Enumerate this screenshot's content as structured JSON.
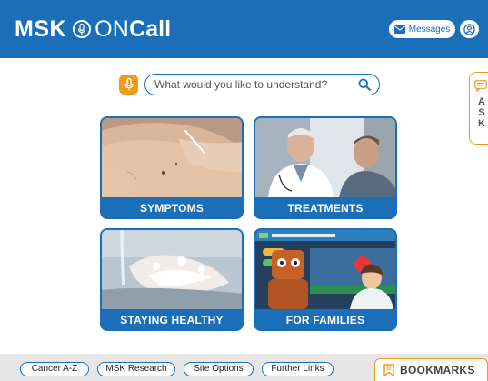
{
  "header": {
    "brand_msk": "MSK",
    "brand_on": "ON",
    "brand_call": "Call",
    "messages_label": "Messages"
  },
  "search": {
    "placeholder": "What would you like to understand?"
  },
  "ask_tab": {
    "letters": "A S K"
  },
  "tiles": [
    {
      "caption": "SYMPTOMS"
    },
    {
      "caption": "TREATMENTS"
    },
    {
      "caption": "STAYING HEALTHY"
    },
    {
      "caption": "FOR FAMILIES"
    }
  ],
  "footer": {
    "links": [
      "Cancer A-Z",
      "MSK Research",
      "Site Options",
      "Further Links"
    ],
    "bookmarks_label": "BOOKMARKS"
  },
  "colors": {
    "brand_blue": "#1a6fb8",
    "accent_orange": "#f09a1c",
    "footer_gray": "#e6e6e6"
  },
  "icons": {
    "mic": "microphone-icon",
    "search": "search-icon",
    "messages": "envelope-icon",
    "user": "user-icon",
    "ask": "chat-bubble-icon",
    "bookmarks": "bookmark-icon"
  }
}
